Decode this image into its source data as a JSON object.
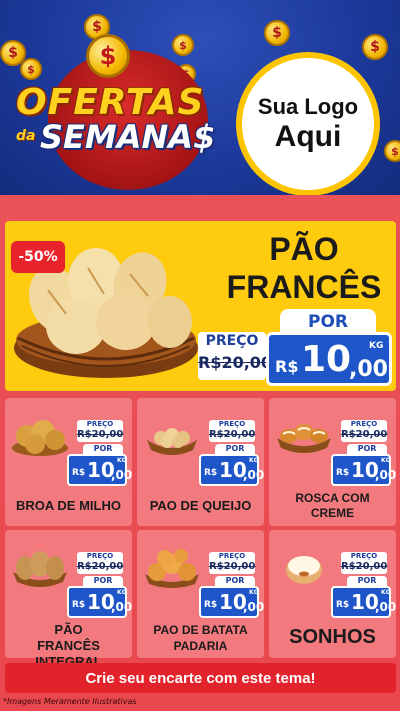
{
  "header": {
    "title_top": "OFERTAS",
    "title_da": "da",
    "title_bottom": "SEMANA$",
    "coin_symbol": "$",
    "logo_line1": "Sua Logo",
    "logo_line2": "Aqui"
  },
  "featured": {
    "discount": "-50%",
    "name_line1": "PÃO",
    "name_line2": "FRANCÊS",
    "preco_label": "PREÇO",
    "old_price": "R$20,00",
    "por_label": "POR",
    "currency": "R$",
    "price_int": "10",
    "price_dec": ",00",
    "unit": "KG",
    "image_icon": "bread-basket-icon"
  },
  "products": [
    {
      "name": "BROA DE MILHO",
      "preco_label": "PREÇO",
      "old_price": "R$20,00",
      "por_label": "POR",
      "currency": "R$",
      "price_int": "10",
      "price_dec": ",00",
      "unit": "KG",
      "icon": "corn-bread-icon"
    },
    {
      "name": "PAO DE QUEIJO",
      "preco_label": "PREÇO",
      "old_price": "R$20,00",
      "por_label": "POR",
      "currency": "R$",
      "price_int": "10",
      "price_dec": ",00",
      "unit": "KG",
      "icon": "cheese-bread-icon"
    },
    {
      "name": "ROSCA COM CREME",
      "preco_label": "PREÇO",
      "old_price": "R$20,00",
      "por_label": "POR",
      "currency": "R$",
      "price_int": "10",
      "price_dec": ",00",
      "unit": "KG",
      "icon": "cream-bread-icon"
    },
    {
      "name": "PÃO FRANCÊS INTEGRAL",
      "preco_label": "PREÇO",
      "old_price": "R$20,00",
      "por_label": "POR",
      "currency": "R$",
      "price_int": "10",
      "price_dec": ",00",
      "unit": "KG",
      "icon": "wholegrain-bread-icon"
    },
    {
      "name": "PAO DE BATATA PADARIA",
      "preco_label": "PREÇO",
      "old_price": "R$20,00",
      "por_label": "POR",
      "currency": "R$",
      "price_int": "10",
      "price_dec": ",00",
      "unit": "KG",
      "icon": "potato-bread-icon"
    },
    {
      "name": "SONHOS",
      "preco_label": "PREÇO",
      "old_price": "R$20,00",
      "por_label": "POR",
      "currency": "R$",
      "price_int": "10",
      "price_dec": ",00",
      "unit": "KG",
      "icon": "donut-icon"
    }
  ],
  "footer": {
    "cta": "Crie seu encarte com este tema!",
    "disclaimer": "*Imagens Meramente Ilustrativas"
  },
  "colors": {
    "header_blue": "#1c3a9c",
    "accent_yellow": "#ffcb0e",
    "main_red": "#e8474d",
    "card_pink": "#f27a7e",
    "price_blue": "#1e56c9",
    "cta_red": "#e3232b"
  }
}
